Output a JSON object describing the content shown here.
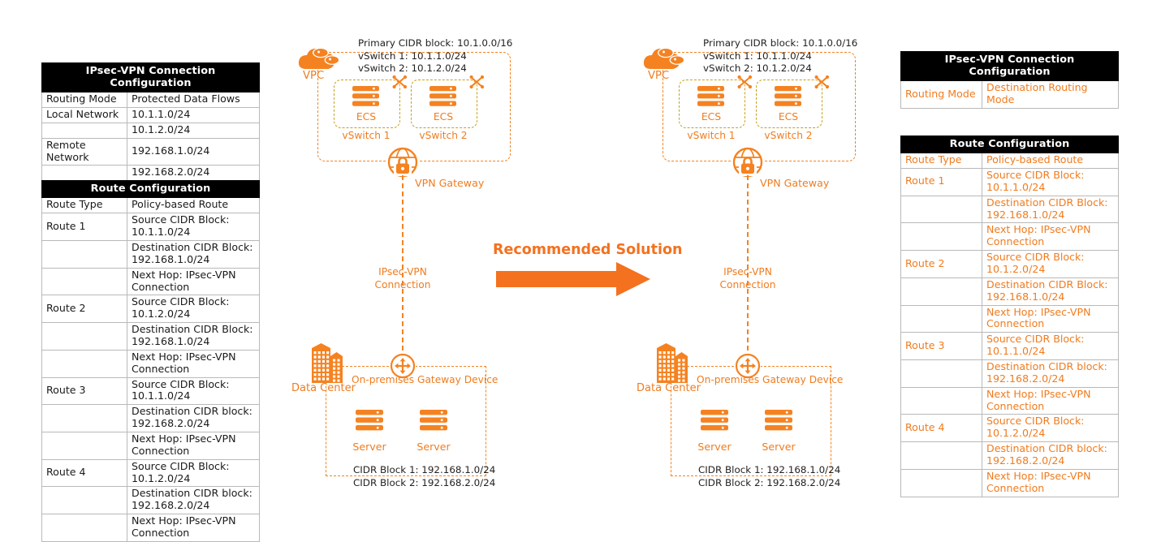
{
  "left_tables": {
    "vpn_config": {
      "title": "IPsec-VPN Connection Configuration",
      "rows": [
        {
          "k": "Routing Mode",
          "v": "Protected Data Flows"
        },
        {
          "k": "Local Network",
          "v": "10.1.1.0/24"
        },
        {
          "k": "",
          "v": "10.1.2.0/24"
        },
        {
          "k": "Remote Network",
          "v": "192.168.1.0/24"
        },
        {
          "k": "",
          "v": "192.168.2.0/24"
        }
      ]
    },
    "route_config": {
      "title": "Route Configuration",
      "rows": [
        {
          "k": "Route Type",
          "v": "Policy-based Route"
        },
        {
          "k": "Route 1",
          "v": "Source CIDR Block:\n10.1.1.0/24"
        },
        {
          "k": "",
          "v": "Destination CIDR Block:\n192.168.1.0/24"
        },
        {
          "k": "",
          "v": "Next Hop: IPsec-VPN\nConnection"
        },
        {
          "k": "Route 2",
          "v": "Source CIDR Block:\n10.1.2.0/24"
        },
        {
          "k": "",
          "v": "Destination CIDR Block:\n192.168.1.0/24"
        },
        {
          "k": "",
          "v": "Next Hop: IPsec-VPN\nConnection"
        },
        {
          "k": "Route 3",
          "v": "Source CIDR Block:\n10.1.1.0/24"
        },
        {
          "k": "",
          "v": "Destination CIDR block:\n192.168.2.0/24"
        },
        {
          "k": "",
          "v": "Next Hop: IPsec-VPN\nConnection"
        },
        {
          "k": "Route 4",
          "v": "Source CIDR Block:\n10.1.2.0/24"
        },
        {
          "k": "",
          "v": "Destination CIDR block:\n192.168.2.0/24"
        },
        {
          "k": "",
          "v": "Next Hop: IPsec-VPN\nConnection"
        }
      ]
    }
  },
  "right_tables": {
    "vpn_config": {
      "title": "IPsec-VPN Connection Configuration",
      "rows": [
        {
          "k": "Routing Mode",
          "v": "Destination Routing Mode"
        }
      ]
    },
    "route_config": {
      "title": "Route Configuration",
      "rows": [
        {
          "k": "Route Type",
          "v": "Policy-based Route"
        },
        {
          "k": "Route 1",
          "v": "Source CIDR Block:\n10.1.1.0/24"
        },
        {
          "k": "",
          "v": "Destination CIDR Block:\n192.168.1.0/24"
        },
        {
          "k": "",
          "v": "Next Hop: IPsec-VPN\nConnection"
        },
        {
          "k": "Route 2",
          "v": "Source CIDR Block:\n10.1.2.0/24"
        },
        {
          "k": "",
          "v": "Destination CIDR Block:\n192.168.1.0/24"
        },
        {
          "k": "",
          "v": "Next Hop: IPsec-VPN\nConnection"
        },
        {
          "k": "Route 3",
          "v": "Source CIDR Block:\n10.1.1.0/24"
        },
        {
          "k": "",
          "v": "Destination CIDR block:\n192.168.2.0/24"
        },
        {
          "k": "",
          "v": "Next Hop: IPsec-VPN\nConnection"
        },
        {
          "k": "Route 4",
          "v": "Source CIDR Block:\n10.1.2.0/24"
        },
        {
          "k": "",
          "v": "Destination CIDR block:\n192.168.2.0/24"
        },
        {
          "k": "",
          "v": "Next Hop: IPsec-VPN\nConnection"
        }
      ]
    }
  },
  "diagram": {
    "vpc_label": "VPC",
    "vpc_cidr_lines": [
      "Primary CIDR block: 10.1.0.0/16",
      "vSwitch 1: 10.1.1.0/24",
      "vSwitch 2: 10.1.2.0/24"
    ],
    "ecs_label": "ECS",
    "vswitch1_label": "vSwitch 1",
    "vswitch2_label": "vSwitch 2",
    "vpn_gateway_label": "VPN Gateway",
    "ipsec_line1": "IPsec-VPN",
    "ipsec_line2": "Connection",
    "data_center_label": "Data Center",
    "gateway_device_label": "On-premises Gateway Device",
    "server_label": "Server",
    "dc_cidr_lines": [
      "CIDR Block 1: 192.168.1.0/24",
      "CIDR Block 2: 192.168.2.0/24"
    ]
  },
  "center": {
    "recommended_label": "Recommended Solution"
  },
  "colors": {
    "orange": "#f58220",
    "orange_text": "#f07c1f",
    "orange_bold": "#f4711f",
    "yellow_dash": "#c8a21a",
    "black": "#000000",
    "grid": "#b9b9b9"
  },
  "icons": {
    "vpc": "cloud-icon",
    "ecs": "server-stack-icon",
    "switch": "network-switch-icon",
    "vpn_gateway": "globe-lock-icon",
    "gateway_device": "router-arrows-icon",
    "data_center": "building-icon",
    "server": "server-stack-icon",
    "arrow": "right-arrow-icon"
  }
}
